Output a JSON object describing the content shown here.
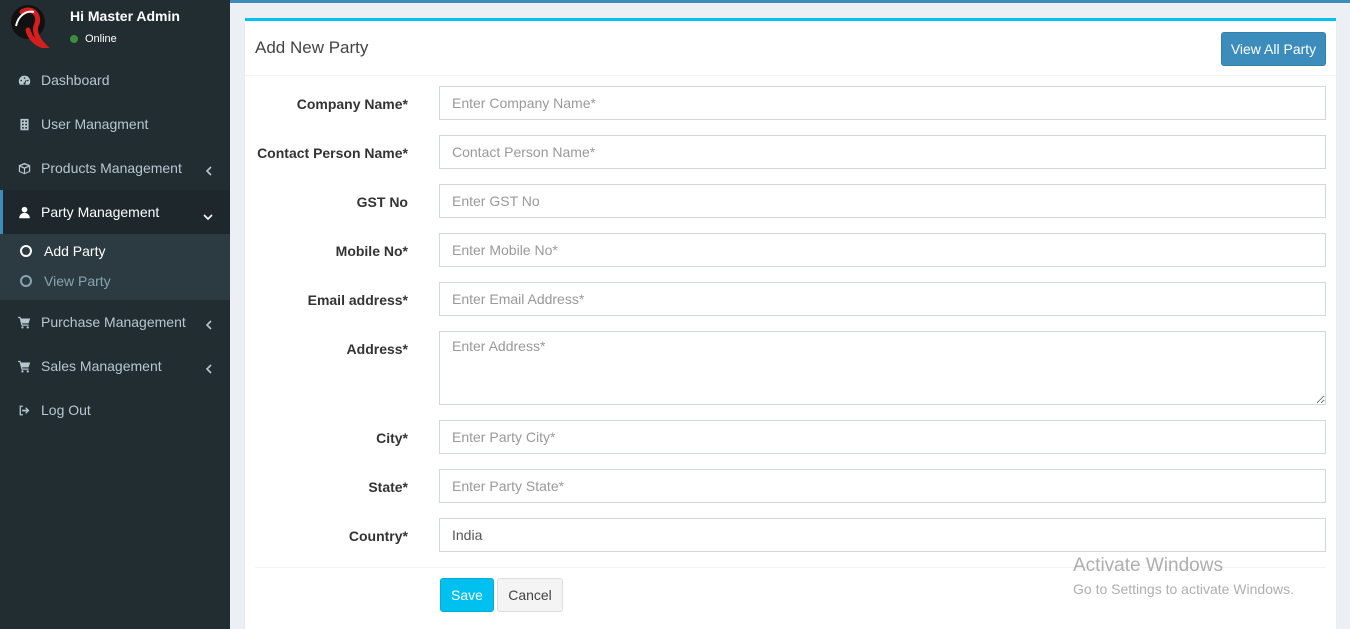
{
  "user": {
    "greeting": "Hi Master Admin",
    "status": "Online"
  },
  "sidebar": {
    "items": [
      {
        "label": "Dashboard",
        "icon": "dashboard-icon"
      },
      {
        "label": "User Managment",
        "icon": "building-icon"
      },
      {
        "label": "Products Management",
        "icon": "cube-icon"
      },
      {
        "label": "Party Management",
        "icon": "user-icon"
      },
      {
        "label": "Purchase Management",
        "icon": "cart-icon"
      },
      {
        "label": "Sales Management",
        "icon": "cart-icon"
      },
      {
        "label": "Log Out",
        "icon": "sign-out-icon"
      }
    ],
    "submenu": [
      {
        "label": "Add Party"
      },
      {
        "label": "View Party"
      }
    ]
  },
  "form": {
    "title": "Add New Party",
    "view_all_label": "View All Party",
    "fields": {
      "company": {
        "label": "Company Name*",
        "placeholder": "Enter Company Name*"
      },
      "contact": {
        "label": "Contact Person Name*",
        "placeholder": "Contact Person Name*"
      },
      "gst": {
        "label": "GST No",
        "placeholder": "Enter GST No"
      },
      "mobile": {
        "label": "Mobile No*",
        "placeholder": "Enter Mobile No*"
      },
      "email": {
        "label": "Email address*",
        "placeholder": "Enter Email Address*"
      },
      "address": {
        "label": "Address*",
        "placeholder": "Enter Address*"
      },
      "city": {
        "label": "City*",
        "placeholder": "Enter Party City*"
      },
      "state": {
        "label": "State*",
        "placeholder": "Enter Party State*"
      },
      "country": {
        "label": "Country*",
        "value": "India"
      }
    },
    "save_label": "Save",
    "cancel_label": "Cancel"
  },
  "watermark": {
    "title": "Activate Windows",
    "subtitle": "Go to Settings to activate Windows."
  },
  "colors": {
    "sidebar_bg": "#222d32",
    "accent": "#3c8dbc",
    "save": "#00c0ef"
  }
}
